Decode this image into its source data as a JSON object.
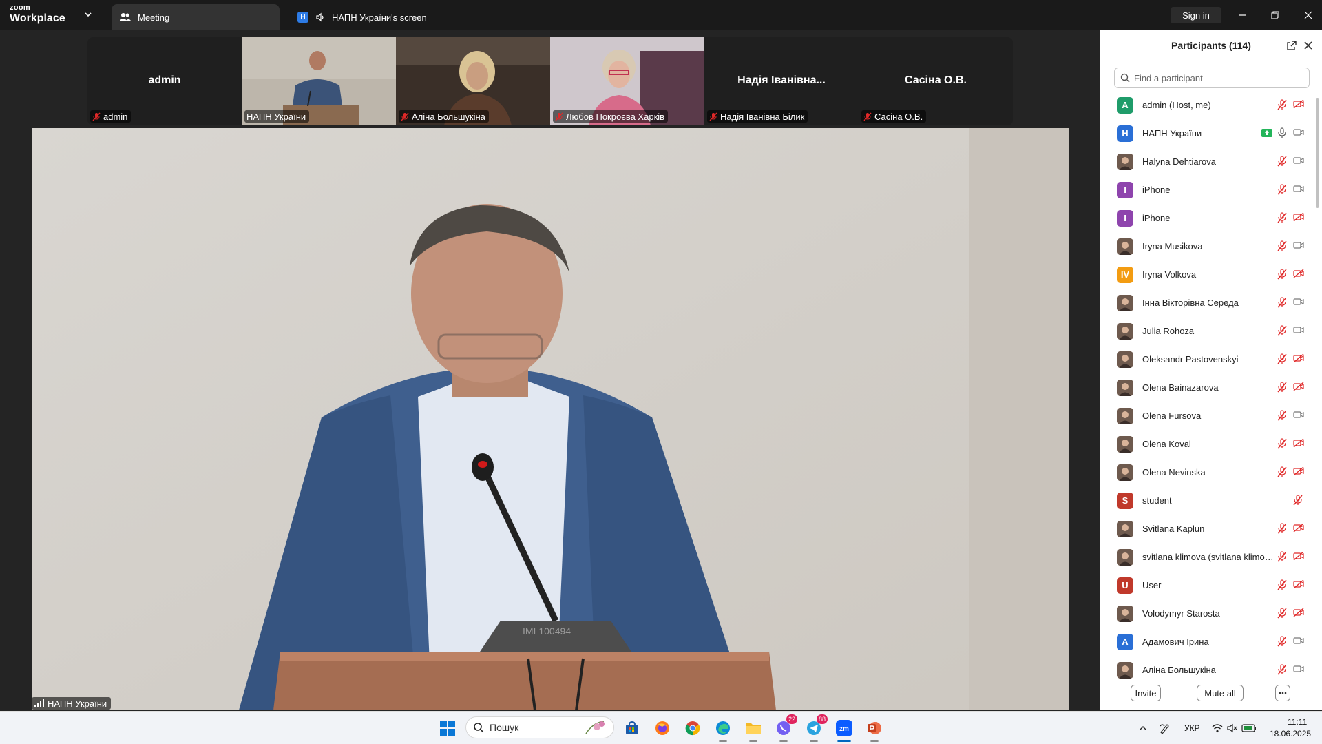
{
  "app": {
    "brand_line1": "zoom",
    "brand_line2": "Workplace",
    "tab_meeting": "Meeting",
    "tab_share_badge": "H",
    "tab_share": "НАПН України's screen",
    "sign_in": "Sign in"
  },
  "gallery": [
    {
      "big_name": "admin",
      "label": "admin",
      "muted": true
    },
    {
      "big_name": "",
      "label": "НАПН України",
      "muted": false,
      "speaking": true
    },
    {
      "big_name": "",
      "label": "Аліна Большукіна",
      "muted": true
    },
    {
      "big_name": "",
      "label": "Любов Покроєва Харків",
      "muted": true
    },
    {
      "big_name": "Надія Іванівна...",
      "label": "Надія Іванівна Білик",
      "muted": true
    },
    {
      "big_name": "Сасіна О.В.",
      "label": "Сасіна О.В.",
      "muted": true
    }
  ],
  "main_video": {
    "label": "НАПН України",
    "mic_text": "IMI 100494"
  },
  "participants": {
    "title": "Participants (114)",
    "search_placeholder": "Find a participant",
    "list": [
      {
        "initial": "A",
        "color": "#1f9c6a",
        "name": "admin (Host, me)",
        "mic": "muted",
        "video": "off"
      },
      {
        "initial": "H",
        "color": "#2a6fd6",
        "name": "НАПН України",
        "mic": "on",
        "video": "on",
        "sharing": true
      },
      {
        "initial": "",
        "color": "photo",
        "name": "Halyna Dehtiarova",
        "mic": "muted",
        "video": "on"
      },
      {
        "initial": "I",
        "color": "#8e44ad",
        "name": "iPhone",
        "mic": "muted",
        "video": "on"
      },
      {
        "initial": "I",
        "color": "#8e44ad",
        "name": "iPhone",
        "mic": "muted",
        "video": "off"
      },
      {
        "initial": "",
        "color": "photo",
        "name": "Iryna Musikova",
        "mic": "muted",
        "video": "on"
      },
      {
        "initial": "IV",
        "color": "#f39c12",
        "name": "Iryna Volkova",
        "mic": "muted",
        "video": "off"
      },
      {
        "initial": "",
        "color": "photo",
        "name": "Інна Вікторівна Середа",
        "mic": "muted",
        "video": "on"
      },
      {
        "initial": "",
        "color": "photo",
        "name": "Julia Rohoza",
        "mic": "muted",
        "video": "on"
      },
      {
        "initial": "",
        "color": "photo",
        "name": "Oleksandr Pastovenskyi",
        "mic": "muted",
        "video": "off"
      },
      {
        "initial": "",
        "color": "photo",
        "name": "Olena Bainazarova",
        "mic": "muted",
        "video": "off"
      },
      {
        "initial": "",
        "color": "photo",
        "name": "Olena Fursova",
        "mic": "muted",
        "video": "on"
      },
      {
        "initial": "",
        "color": "photo",
        "name": "Olena Koval",
        "mic": "muted",
        "video": "off"
      },
      {
        "initial": "",
        "color": "photo",
        "name": "Olena Nevinska",
        "mic": "muted",
        "video": "off"
      },
      {
        "initial": "S",
        "color": "#c0392b",
        "name": "student",
        "mic": "muted",
        "video": "none"
      },
      {
        "initial": "",
        "color": "photo",
        "name": "Svitlana Kaplun",
        "mic": "muted",
        "video": "off"
      },
      {
        "initial": "",
        "color": "photo",
        "name": "svitlana klimova (svitlana klimova)",
        "mic": "muted",
        "video": "off"
      },
      {
        "initial": "U",
        "color": "#c0392b",
        "name": "User",
        "mic": "muted",
        "video": "off"
      },
      {
        "initial": "",
        "color": "photo",
        "name": "Volodymyr Starosta",
        "mic": "muted",
        "video": "off"
      },
      {
        "initial": "A",
        "color": "#2a6fd6",
        "name": "Адамович Ірина",
        "mic": "muted",
        "video": "on"
      },
      {
        "initial": "",
        "color": "photo",
        "name": "Аліна Большукіна",
        "mic": "muted",
        "video": "on"
      }
    ],
    "invite": "Invite",
    "mute_all": "Mute all"
  },
  "taskbar": {
    "search_text": "Пошук",
    "viber_badge": "22",
    "telegram_badge": "88",
    "zoom_label": "zm",
    "language": "УКР",
    "time": "11:11",
    "date": "18.06.2025"
  },
  "colors": {
    "speaking_outline": "#23d959",
    "muted_red": "#e02828",
    "accent_blue": "#0e72ed"
  }
}
